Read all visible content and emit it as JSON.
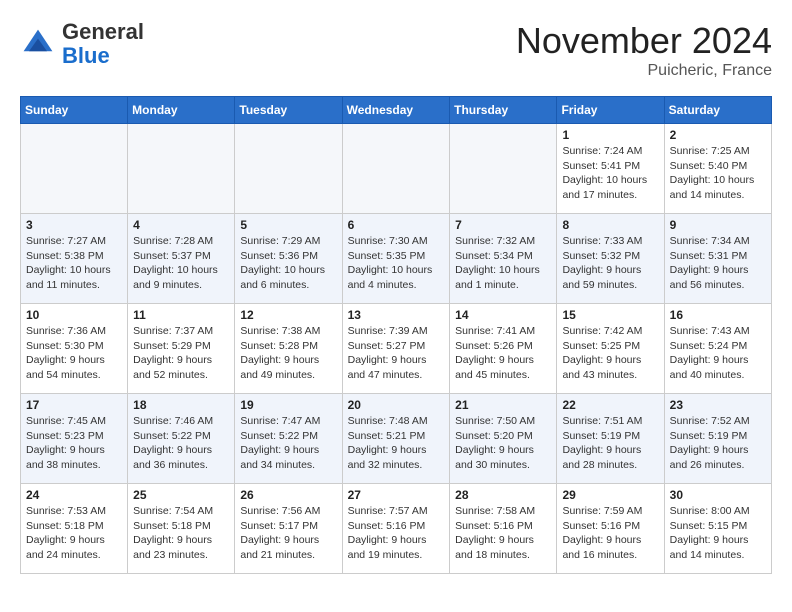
{
  "header": {
    "logo_general": "General",
    "logo_blue": "Blue",
    "month_title": "November 2024",
    "location": "Puicheric, France"
  },
  "calendar": {
    "days_of_week": [
      "Sunday",
      "Monday",
      "Tuesday",
      "Wednesday",
      "Thursday",
      "Friday",
      "Saturday"
    ],
    "weeks": [
      [
        {
          "day": "",
          "empty": true
        },
        {
          "day": "",
          "empty": true
        },
        {
          "day": "",
          "empty": true
        },
        {
          "day": "",
          "empty": true
        },
        {
          "day": "",
          "empty": true
        },
        {
          "day": "1",
          "sunrise": "7:24 AM",
          "sunset": "5:41 PM",
          "daylight": "10 hours and 17 minutes."
        },
        {
          "day": "2",
          "sunrise": "7:25 AM",
          "sunset": "5:40 PM",
          "daylight": "10 hours and 14 minutes."
        }
      ],
      [
        {
          "day": "3",
          "sunrise": "7:27 AM",
          "sunset": "5:38 PM",
          "daylight": "10 hours and 11 minutes."
        },
        {
          "day": "4",
          "sunrise": "7:28 AM",
          "sunset": "5:37 PM",
          "daylight": "10 hours and 9 minutes."
        },
        {
          "day": "5",
          "sunrise": "7:29 AM",
          "sunset": "5:36 PM",
          "daylight": "10 hours and 6 minutes."
        },
        {
          "day": "6",
          "sunrise": "7:30 AM",
          "sunset": "5:35 PM",
          "daylight": "10 hours and 4 minutes."
        },
        {
          "day": "7",
          "sunrise": "7:32 AM",
          "sunset": "5:34 PM",
          "daylight": "10 hours and 1 minute."
        },
        {
          "day": "8",
          "sunrise": "7:33 AM",
          "sunset": "5:32 PM",
          "daylight": "9 hours and 59 minutes."
        },
        {
          "day": "9",
          "sunrise": "7:34 AM",
          "sunset": "5:31 PM",
          "daylight": "9 hours and 56 minutes."
        }
      ],
      [
        {
          "day": "10",
          "sunrise": "7:36 AM",
          "sunset": "5:30 PM",
          "daylight": "9 hours and 54 minutes."
        },
        {
          "day": "11",
          "sunrise": "7:37 AM",
          "sunset": "5:29 PM",
          "daylight": "9 hours and 52 minutes."
        },
        {
          "day": "12",
          "sunrise": "7:38 AM",
          "sunset": "5:28 PM",
          "daylight": "9 hours and 49 minutes."
        },
        {
          "day": "13",
          "sunrise": "7:39 AM",
          "sunset": "5:27 PM",
          "daylight": "9 hours and 47 minutes."
        },
        {
          "day": "14",
          "sunrise": "7:41 AM",
          "sunset": "5:26 PM",
          "daylight": "9 hours and 45 minutes."
        },
        {
          "day": "15",
          "sunrise": "7:42 AM",
          "sunset": "5:25 PM",
          "daylight": "9 hours and 43 minutes."
        },
        {
          "day": "16",
          "sunrise": "7:43 AM",
          "sunset": "5:24 PM",
          "daylight": "9 hours and 40 minutes."
        }
      ],
      [
        {
          "day": "17",
          "sunrise": "7:45 AM",
          "sunset": "5:23 PM",
          "daylight": "9 hours and 38 minutes."
        },
        {
          "day": "18",
          "sunrise": "7:46 AM",
          "sunset": "5:22 PM",
          "daylight": "9 hours and 36 minutes."
        },
        {
          "day": "19",
          "sunrise": "7:47 AM",
          "sunset": "5:22 PM",
          "daylight": "9 hours and 34 minutes."
        },
        {
          "day": "20",
          "sunrise": "7:48 AM",
          "sunset": "5:21 PM",
          "daylight": "9 hours and 32 minutes."
        },
        {
          "day": "21",
          "sunrise": "7:50 AM",
          "sunset": "5:20 PM",
          "daylight": "9 hours and 30 minutes."
        },
        {
          "day": "22",
          "sunrise": "7:51 AM",
          "sunset": "5:19 PM",
          "daylight": "9 hours and 28 minutes."
        },
        {
          "day": "23",
          "sunrise": "7:52 AM",
          "sunset": "5:19 PM",
          "daylight": "9 hours and 26 minutes."
        }
      ],
      [
        {
          "day": "24",
          "sunrise": "7:53 AM",
          "sunset": "5:18 PM",
          "daylight": "9 hours and 24 minutes."
        },
        {
          "day": "25",
          "sunrise": "7:54 AM",
          "sunset": "5:18 PM",
          "daylight": "9 hours and 23 minutes."
        },
        {
          "day": "26",
          "sunrise": "7:56 AM",
          "sunset": "5:17 PM",
          "daylight": "9 hours and 21 minutes."
        },
        {
          "day": "27",
          "sunrise": "7:57 AM",
          "sunset": "5:16 PM",
          "daylight": "9 hours and 19 minutes."
        },
        {
          "day": "28",
          "sunrise": "7:58 AM",
          "sunset": "5:16 PM",
          "daylight": "9 hours and 18 minutes."
        },
        {
          "day": "29",
          "sunrise": "7:59 AM",
          "sunset": "5:16 PM",
          "daylight": "9 hours and 16 minutes."
        },
        {
          "day": "30",
          "sunrise": "8:00 AM",
          "sunset": "5:15 PM",
          "daylight": "9 hours and 14 minutes."
        }
      ]
    ]
  }
}
